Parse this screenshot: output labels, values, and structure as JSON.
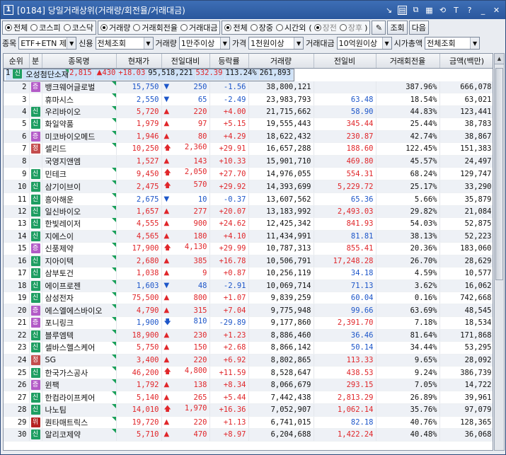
{
  "window": {
    "num": "1",
    "title": "[0184] 당일거래상위(거래량/회전율/거래대금)"
  },
  "toolbar": {
    "market": [
      {
        "label": "전체",
        "on": true
      },
      {
        "label": "코스피",
        "on": false
      },
      {
        "label": "코스닥",
        "on": false
      }
    ],
    "sort": [
      {
        "label": "거래량",
        "on": true
      },
      {
        "label": "거래회전율",
        "on": false
      },
      {
        "label": "거래대금",
        "on": false
      }
    ],
    "session": [
      {
        "label": "전체",
        "on": true
      },
      {
        "label": "장중",
        "on": false
      },
      {
        "label": "시간외",
        "on": false
      }
    ],
    "sub_session": [
      {
        "label": "장전",
        "on": true
      },
      {
        "label": "장후",
        "on": false
      }
    ],
    "lookup_label": "조회",
    "next_label": "다음"
  },
  "filters": {
    "item_label": "종목",
    "item_value": "ETF+ETN 제",
    "credit_label": "신용",
    "credit_value": "전체조회",
    "volume_label": "거래량",
    "volume_value": "1만주이상",
    "price_label": "가격",
    "price_value": "1천원이상",
    "amount_label": "거래대금",
    "amount_value": "10억원이상",
    "cap_label": "시가총액",
    "cap_value": "전체조회"
  },
  "columns": [
    "순위",
    "분",
    "종목명",
    "현재가",
    "전일대비",
    "등락률",
    "거래량",
    "전일비",
    "거래회전율",
    "금액(백만)"
  ],
  "badge_colors": {
    "신": "#1e9e62",
    "증": "#b35bc7",
    "정": "#c44d4d",
    "위": "#b52222"
  },
  "rows": [
    {
      "rank": "1",
      "badge": "신",
      "name": "오성첨단소재",
      "price": "2,815",
      "dir": "up",
      "diff": "430",
      "rate": "+18.03",
      "vol": "95,518,221",
      "prev": "532.39",
      "turn": "113.24%",
      "amt": "261,893",
      "tri": true
    },
    {
      "rank": "2",
      "badge": "증",
      "name": "뱅크웨어글로벌",
      "price": "15,750",
      "dir": "down",
      "diff": "250",
      "rate": "-1.56",
      "vol": "38,800,121",
      "prev": "",
      "turn": "387.96%",
      "amt": "666,078",
      "tri": true
    },
    {
      "rank": "3",
      "badge": "",
      "name": "휴마시스",
      "price": "2,550",
      "dir": "down",
      "diff": "65",
      "rate": "-2.49",
      "vol": "23,983,793",
      "prev": "63.48",
      "turn": "18.54%",
      "amt": "63,021",
      "tri": true
    },
    {
      "rank": "4",
      "badge": "신",
      "name": "우리바이오",
      "price": "5,720",
      "dir": "up",
      "diff": "220",
      "rate": "+4.00",
      "vol": "21,715,662",
      "prev": "58.90",
      "turn": "44.83%",
      "amt": "123,441",
      "tri": true
    },
    {
      "rank": "5",
      "badge": "신",
      "name": "화일약품",
      "price": "1,979",
      "dir": "up",
      "diff": "97",
      "rate": "+5.15",
      "vol": "19,555,443",
      "prev": "345.44",
      "turn": "25.44%",
      "amt": "38,783",
      "tri": true
    },
    {
      "rank": "6",
      "badge": "증",
      "name": "미코바이오메드",
      "price": "1,946",
      "dir": "up",
      "diff": "80",
      "rate": "+4.29",
      "vol": "18,622,432",
      "prev": "230.87",
      "turn": "42.74%",
      "amt": "38,867",
      "tri": true
    },
    {
      "rank": "7",
      "badge": "정",
      "name": "셀리드",
      "price": "10,250",
      "dir": "limitup",
      "diff": "2,360",
      "rate": "+29.91",
      "vol": "16,657,288",
      "prev": "188.60",
      "turn": "122.45%",
      "amt": "151,383",
      "tri": true
    },
    {
      "rank": "8",
      "badge": "",
      "name": "국영지앤엠",
      "price": "1,527",
      "dir": "up",
      "diff": "143",
      "rate": "+10.33",
      "vol": "15,901,710",
      "prev": "469.80",
      "turn": "45.57%",
      "amt": "24,497",
      "tri": false
    },
    {
      "rank": "9",
      "badge": "신",
      "name": "민테크",
      "price": "9,450",
      "dir": "limitup",
      "diff": "2,050",
      "rate": "+27.70",
      "vol": "14,976,055",
      "prev": "554.31",
      "turn": "68.24%",
      "amt": "129,747",
      "tri": true
    },
    {
      "rank": "10",
      "badge": "신",
      "name": "삼기이브이",
      "price": "2,475",
      "dir": "limitup",
      "diff": "570",
      "rate": "+29.92",
      "vol": "14,393,699",
      "prev": "5,229.72",
      "turn": "25.17%",
      "amt": "33,290",
      "tri": true
    },
    {
      "rank": "11",
      "badge": "신",
      "name": "흥아해운",
      "price": "2,675",
      "dir": "down",
      "diff": "10",
      "rate": "-0.37",
      "vol": "13,607,562",
      "prev": "65.36",
      "turn": "5.66%",
      "amt": "35,879",
      "tri": true
    },
    {
      "rank": "12",
      "badge": "신",
      "name": "일신바이오",
      "price": "1,657",
      "dir": "up",
      "diff": "277",
      "rate": "+20.07",
      "vol": "13,183,992",
      "prev": "2,493.03",
      "turn": "29.82%",
      "amt": "21,084",
      "tri": true
    },
    {
      "rank": "13",
      "badge": "신",
      "name": "한빛레이저",
      "price": "4,555",
      "dir": "up",
      "diff": "900",
      "rate": "+24.62",
      "vol": "12,425,342",
      "prev": "841.93",
      "turn": "54.03%",
      "amt": "52,875",
      "tri": true
    },
    {
      "rank": "14",
      "badge": "신",
      "name": "지에스이",
      "price": "4,565",
      "dir": "up",
      "diff": "180",
      "rate": "+4.10",
      "vol": "11,434,991",
      "prev": "81.81",
      "turn": "38.13%",
      "amt": "52,223",
      "tri": true
    },
    {
      "rank": "15",
      "badge": "증",
      "name": "신풍제약",
      "price": "17,900",
      "dir": "limitup",
      "diff": "4,130",
      "rate": "+29.99",
      "vol": "10,787,313",
      "prev": "855.41",
      "turn": "20.36%",
      "amt": "183,060",
      "tri": true
    },
    {
      "rank": "16",
      "badge": "신",
      "name": "지아이텍",
      "price": "2,680",
      "dir": "up",
      "diff": "385",
      "rate": "+16.78",
      "vol": "10,506,791",
      "prev": "17,248.28",
      "turn": "26.70%",
      "amt": "28,629",
      "tri": true
    },
    {
      "rank": "17",
      "badge": "신",
      "name": "삼부토건",
      "price": "1,038",
      "dir": "up",
      "diff": "9",
      "rate": "+0.87",
      "vol": "10,256,119",
      "prev": "34.18",
      "turn": "4.59%",
      "amt": "10,577",
      "tri": true
    },
    {
      "rank": "18",
      "badge": "신",
      "name": "에이프로젠",
      "price": "1,603",
      "dir": "down",
      "diff": "48",
      "rate": "-2.91",
      "vol": "10,069,714",
      "prev": "71.13",
      "turn": "3.62%",
      "amt": "16,062",
      "tri": true
    },
    {
      "rank": "19",
      "badge": "신",
      "name": "삼성전자",
      "price": "75,500",
      "dir": "up",
      "diff": "800",
      "rate": "+1.07",
      "vol": "9,839,259",
      "prev": "60.04",
      "turn": "0.16%",
      "amt": "742,668",
      "tri": true
    },
    {
      "rank": "20",
      "badge": "증",
      "name": "에스엘에스바이오",
      "price": "4,790",
      "dir": "up",
      "diff": "315",
      "rate": "+7.04",
      "vol": "9,775,948",
      "prev": "99.66",
      "turn": "63.69%",
      "amt": "48,545",
      "tri": true
    },
    {
      "rank": "21",
      "badge": "증",
      "name": "포니링크",
      "price": "1,900",
      "dir": "limitdown",
      "diff": "810",
      "rate": "-29.89",
      "vol": "9,177,860",
      "prev": "2,391.70",
      "turn": "7.18%",
      "amt": "18,534",
      "tri": true
    },
    {
      "rank": "22",
      "badge": "신",
      "name": "블루엠텍",
      "price": "18,900",
      "dir": "up",
      "diff": "230",
      "rate": "+1.23",
      "vol": "8,886,460",
      "prev": "36.46",
      "turn": "81.64%",
      "amt": "171,868",
      "tri": true
    },
    {
      "rank": "23",
      "badge": "신",
      "name": "셀바스헬스케어",
      "price": "5,750",
      "dir": "up",
      "diff": "150",
      "rate": "+2.68",
      "vol": "8,866,142",
      "prev": "50.14",
      "turn": "34.44%",
      "amt": "53,295",
      "tri": true
    },
    {
      "rank": "24",
      "badge": "정",
      "name": "SG",
      "price": "3,400",
      "dir": "up",
      "diff": "220",
      "rate": "+6.92",
      "vol": "8,802,865",
      "prev": "113.33",
      "turn": "9.65%",
      "amt": "28,092",
      "tri": true
    },
    {
      "rank": "25",
      "badge": "신",
      "name": "한국가스공사",
      "price": "46,200",
      "dir": "limitup",
      "diff": "4,800",
      "rate": "+11.59",
      "vol": "8,528,647",
      "prev": "438.53",
      "turn": "9.24%",
      "amt": "386,739",
      "tri": true
    },
    {
      "rank": "26",
      "badge": "증",
      "name": "윈팩",
      "price": "1,792",
      "dir": "up",
      "diff": "138",
      "rate": "+8.34",
      "vol": "8,066,679",
      "prev": "293.15",
      "turn": "7.05%",
      "amt": "14,722",
      "tri": true
    },
    {
      "rank": "27",
      "badge": "신",
      "name": "한컴라이프케어",
      "price": "5,140",
      "dir": "up",
      "diff": "265",
      "rate": "+5.44",
      "vol": "7,442,438",
      "prev": "2,813.29",
      "turn": "26.89%",
      "amt": "39,961",
      "tri": true
    },
    {
      "rank": "28",
      "badge": "신",
      "name": "나노팀",
      "price": "14,010",
      "dir": "limitup",
      "diff": "1,970",
      "rate": "+16.36",
      "vol": "7,052,907",
      "prev": "1,062.14",
      "turn": "35.76%",
      "amt": "97,079",
      "tri": true
    },
    {
      "rank": "29",
      "badge": "위",
      "name": "퀀타매트릭스",
      "price": "19,720",
      "dir": "up",
      "diff": "220",
      "rate": "+1.13",
      "vol": "6,741,015",
      "prev": "82.18",
      "turn": "40.76%",
      "amt": "128,365",
      "tri": true
    },
    {
      "rank": "30",
      "badge": "신",
      "name": "알리코제약",
      "price": "5,710",
      "dir": "up",
      "diff": "470",
      "rate": "+8.97",
      "vol": "6,204,688",
      "prev": "1,422.24",
      "turn": "40.48%",
      "amt": "36,068",
      "tri": true
    }
  ]
}
